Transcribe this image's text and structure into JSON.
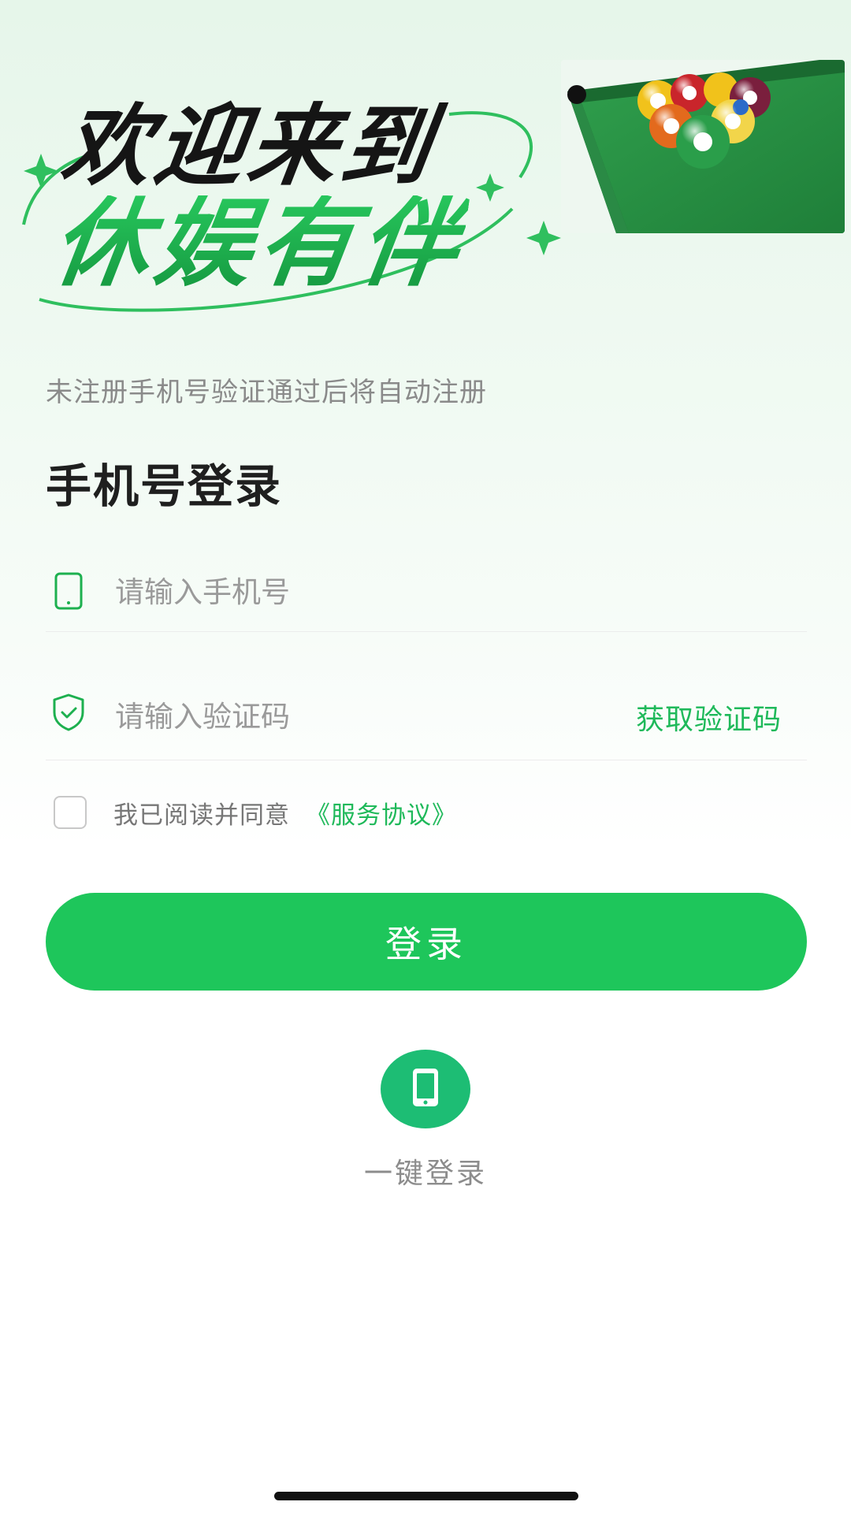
{
  "hero": {
    "line1": "欢迎来到",
    "line2": "休娱有伴",
    "table_image_icon": "billiards-table-image"
  },
  "hint": "未注册手机号验证通过后将自动注册",
  "title": "手机号登录",
  "phone_field": {
    "icon": "phone-outline-icon",
    "placeholder": "请输入手机号"
  },
  "code_field": {
    "icon": "shield-check-icon",
    "placeholder": "请输入验证码",
    "get_code_label": "获取验证码"
  },
  "agreement": {
    "checked": false,
    "text": "我已阅读并同意",
    "link": "《服务协议》"
  },
  "login_button": "登录",
  "quick_login": {
    "icon": "mobile-phone-icon",
    "label": "一键登录"
  },
  "colors": {
    "accent": "#1ec65b",
    "accent_text": "#1fb95a",
    "quick_circle": "#1dbd74"
  }
}
